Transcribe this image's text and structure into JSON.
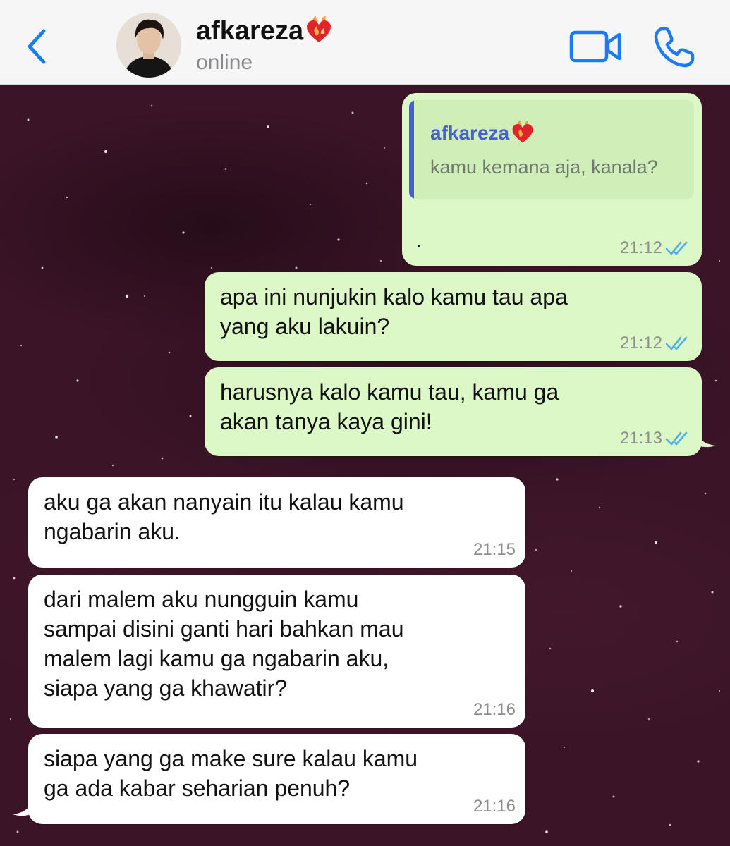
{
  "header": {
    "contact_name": "afkareza",
    "status": "online",
    "icons": {
      "back": "chevron-left-icon",
      "video": "video-camera-icon",
      "call": "phone-icon",
      "name_emoji": "burning-heart-emoji"
    }
  },
  "messages": [
    {
      "direction": "outgoing",
      "quoted": {
        "author": "afkareza",
        "text": "kamu kemana aja, kanala?"
      },
      "text": ".",
      "time": "21:12",
      "status": "read"
    },
    {
      "direction": "outgoing",
      "text": "apa ini nunjukin kalo kamu tau apa\nyang aku lakuin?",
      "time": "21:12",
      "status": "read"
    },
    {
      "direction": "outgoing",
      "text": "harusnya kalo kamu tau, kamu ga\nakan tanya kaya gini!",
      "time": "21:13",
      "status": "read"
    },
    {
      "direction": "incoming",
      "text": "aku ga akan nanyain itu kalau kamu\nngabarin aku.",
      "time": "21:15"
    },
    {
      "direction": "incoming",
      "text": "dari malem aku nungguin kamu\nsampai disini ganti hari bahkan mau\nmalem lagi kamu ga ngabarin aku,\nsiapa yang ga khawatir?",
      "time": "21:16"
    },
    {
      "direction": "incoming",
      "text": "siapa yang ga make sure kalau kamu\nga ada kabar seharian penuh?",
      "time": "21:16"
    }
  ],
  "colors": {
    "outgoing_bubble": "#dcf8c6",
    "incoming_bubble": "#ffffff",
    "accent_blue": "#1a7cf5",
    "read_ticks": "#4fb0e8",
    "quote_author": "#4a5fd6"
  }
}
